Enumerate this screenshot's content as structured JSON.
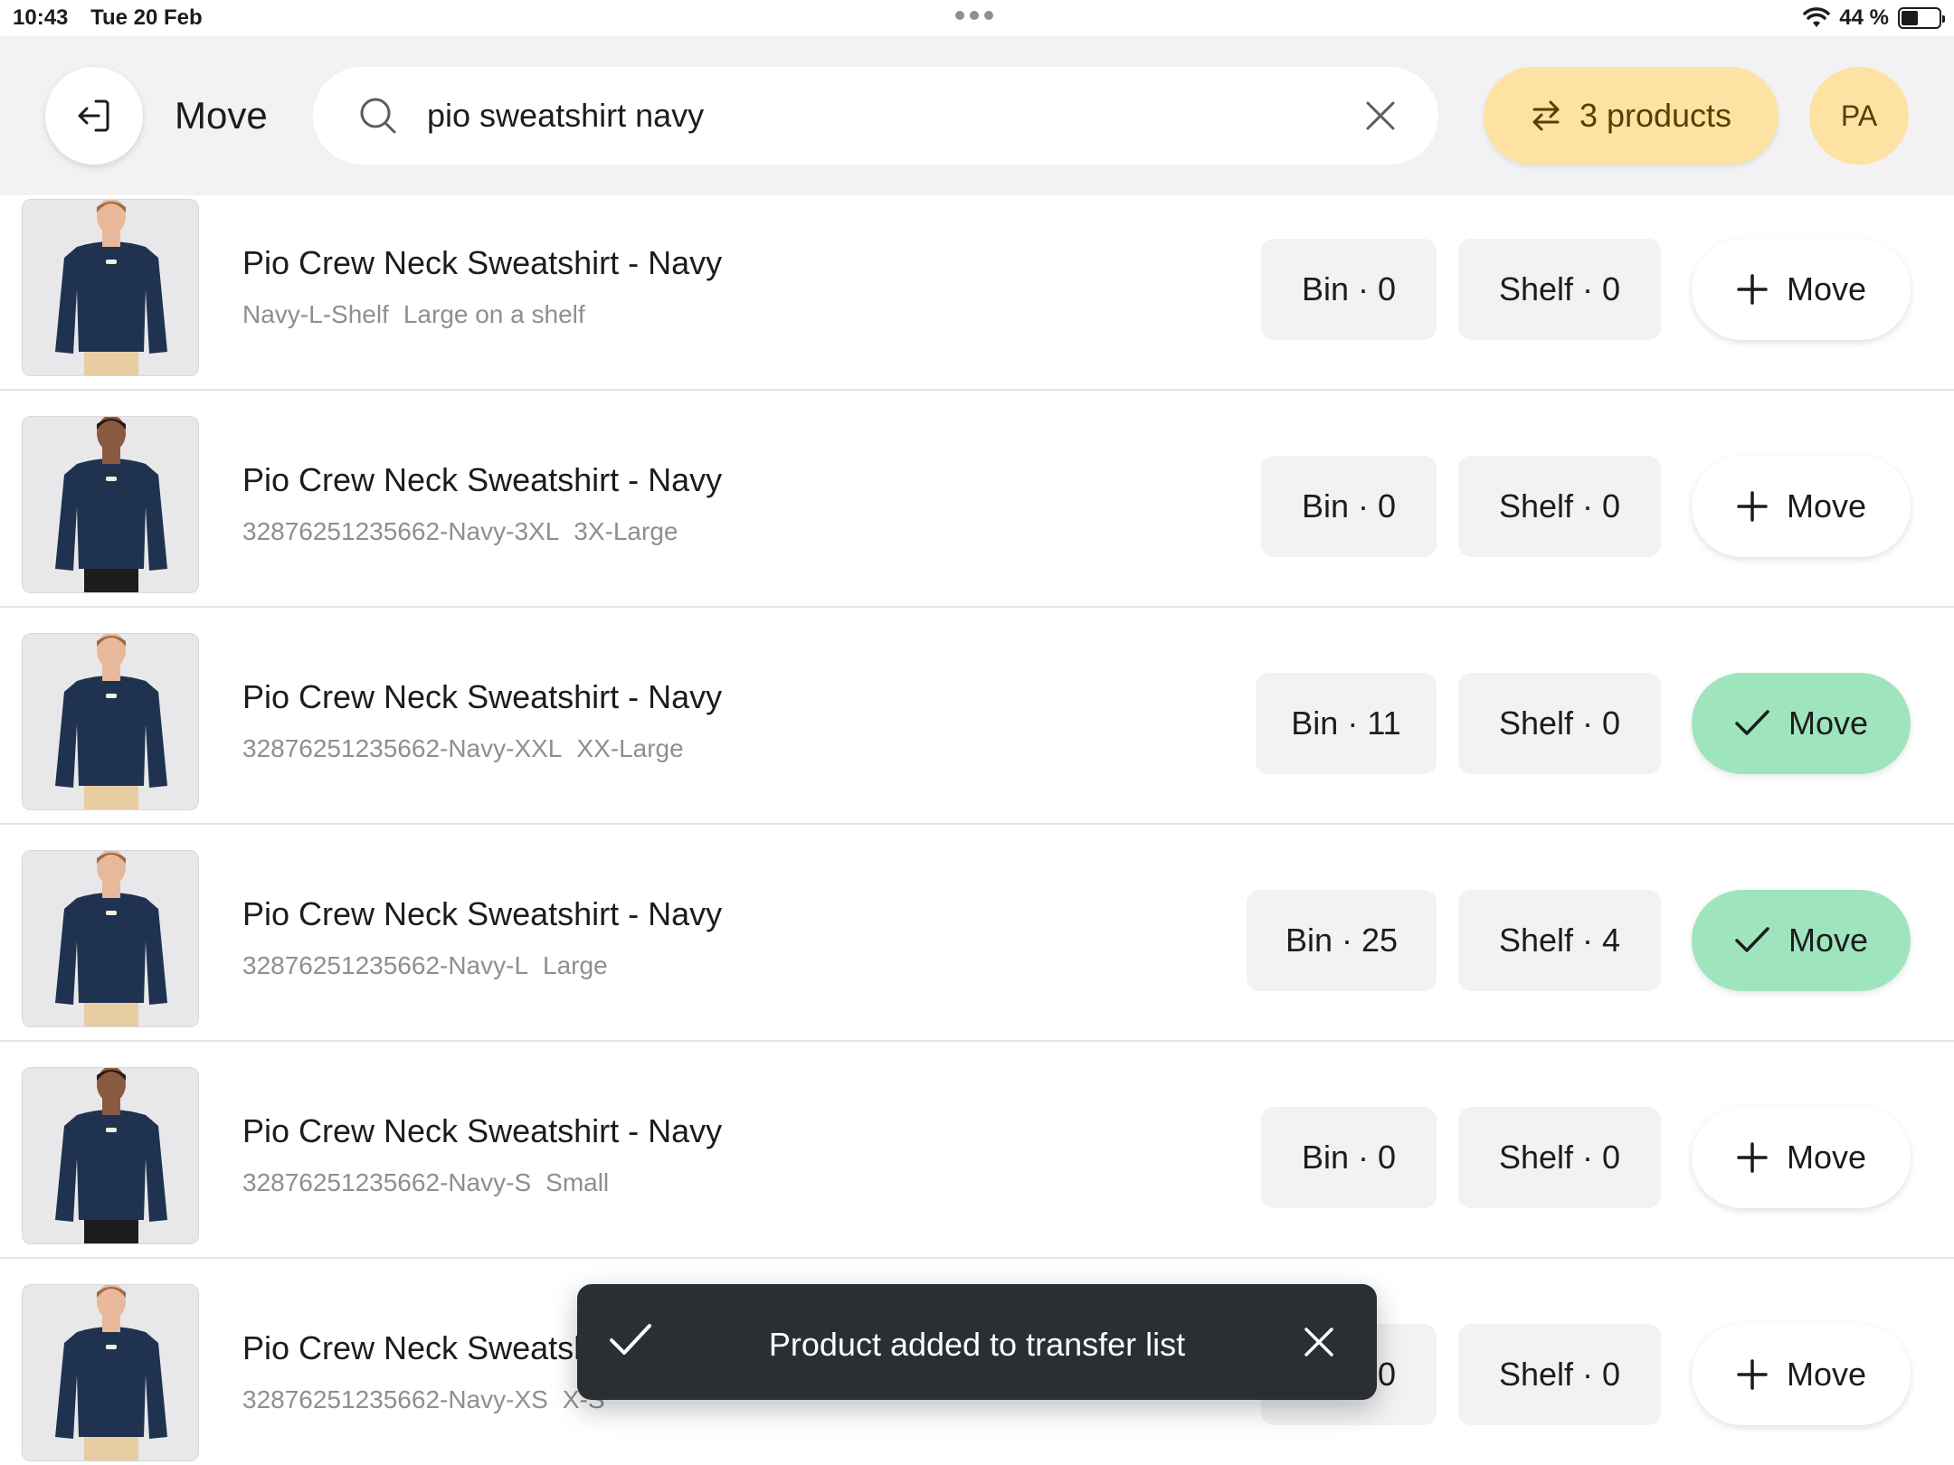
{
  "status": {
    "time": "10:43",
    "date": "Tue 20 Feb",
    "battery": "44 %"
  },
  "header": {
    "title": "Move",
    "products_label": "3 products",
    "avatar_initials": "PA"
  },
  "search": {
    "value": "pio sweatshirt navy",
    "placeholder": ""
  },
  "rows": [
    {
      "name": "Pio Crew Neck Sweatshirt - Navy",
      "sku": "Navy-L-Shelf",
      "variant": "Large on a shelf",
      "bin": "Bin · 0",
      "shelf": "Shelf · 0",
      "move": "Move",
      "added": false,
      "model": "woman"
    },
    {
      "name": "Pio Crew Neck Sweatshirt - Navy",
      "sku": "32876251235662-Navy-3XL",
      "variant": "3X-Large",
      "bin": "Bin · 0",
      "shelf": "Shelf · 0",
      "move": "Move",
      "added": false,
      "model": "man"
    },
    {
      "name": "Pio Crew Neck Sweatshirt - Navy",
      "sku": "32876251235662-Navy-XXL",
      "variant": "XX-Large",
      "bin": "Bin · 11",
      "shelf": "Shelf · 0",
      "move": "Move",
      "added": true,
      "model": "woman"
    },
    {
      "name": "Pio Crew Neck Sweatshirt - Navy",
      "sku": "32876251235662-Navy-L",
      "variant": "Large",
      "bin": "Bin · 25",
      "shelf": "Shelf · 4",
      "move": "Move",
      "added": true,
      "model": "woman"
    },
    {
      "name": "Pio Crew Neck Sweatshirt - Navy",
      "sku": "32876251235662-Navy-S",
      "variant": "Small",
      "bin": "Bin · 0",
      "shelf": "Shelf · 0",
      "move": "Move",
      "added": false,
      "model": "man"
    },
    {
      "name": "Pio Crew Neck Sweatsh",
      "sku": "32876251235662-Navy-XS",
      "variant": "X-S",
      "bin": "Bin · 0",
      "shelf": "Shelf · 0",
      "move": "Move",
      "added": false,
      "model": "woman"
    }
  ],
  "toast": {
    "message": "Product added to transfer list"
  },
  "colors": {
    "accent_yellow": "#fde2a3",
    "added_green": "#9ee5bd",
    "toast_bg": "#2a2f33",
    "sweatshirt_navy": "#1f3350"
  }
}
